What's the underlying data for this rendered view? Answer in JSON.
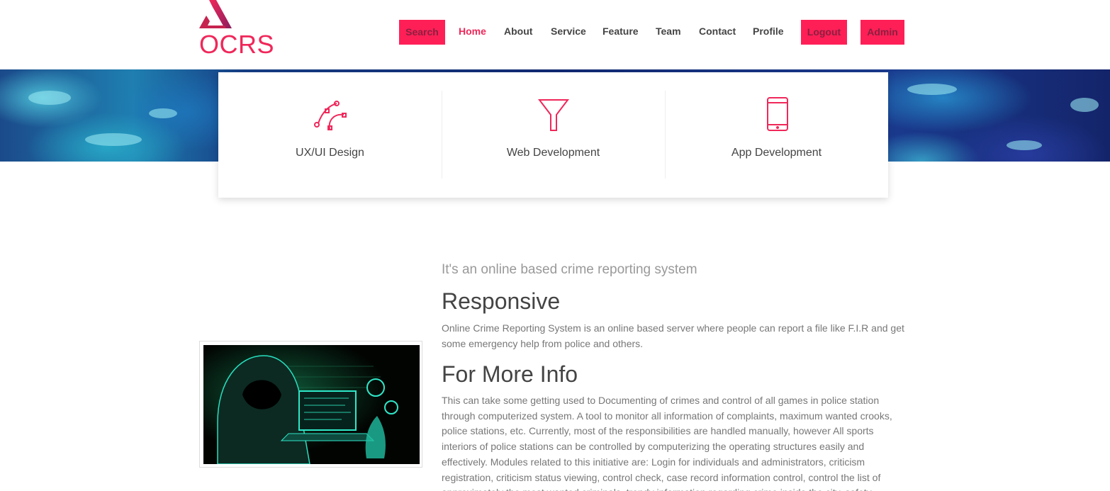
{
  "brand": {
    "name": "OCRS",
    "accent": "#f0275a",
    "button_bg": "#ff1f57"
  },
  "nav": {
    "search": "Search",
    "links": [
      "Home",
      "About",
      "Service",
      "Feature",
      "Team",
      "Contact",
      "Profile"
    ],
    "active": "Home",
    "logout": "Logout",
    "admin": "Admin"
  },
  "services": [
    {
      "title": "UX/UI Design",
      "icon": "bezier-curve-icon"
    },
    {
      "title": "Web Development",
      "icon": "funnel-icon"
    },
    {
      "title": "App Development",
      "icon": "mobile-phone-icon"
    }
  ],
  "about": {
    "tagline": "It's an online based crime reporting system",
    "heading1": "Responsive",
    "paragraph1": "Online Crime Reporting System is an online based server where people can report a file like F.I.R and get some emergency help from police and others.",
    "heading2": "For More Info",
    "paragraph2": "This can take some getting used to Documenting of crimes and control of all games in police station through computerized system. A tool to monitor all information of complaints, maximum wanted crooks, police stations, etc. Currently, most of the responsibilities are handled manually, however All sports interiors of police stations can be controlled by computerizing the operating structures easily and effectively. Modules related to this initiative are: Login for individuals and administrators, criticism registration, criticism status viewing, control check, case record information control, control the list of approximately the most wanted criminals, trendy information regarding crime inside the city, safety",
    "image": "hooded-hacker-image"
  }
}
